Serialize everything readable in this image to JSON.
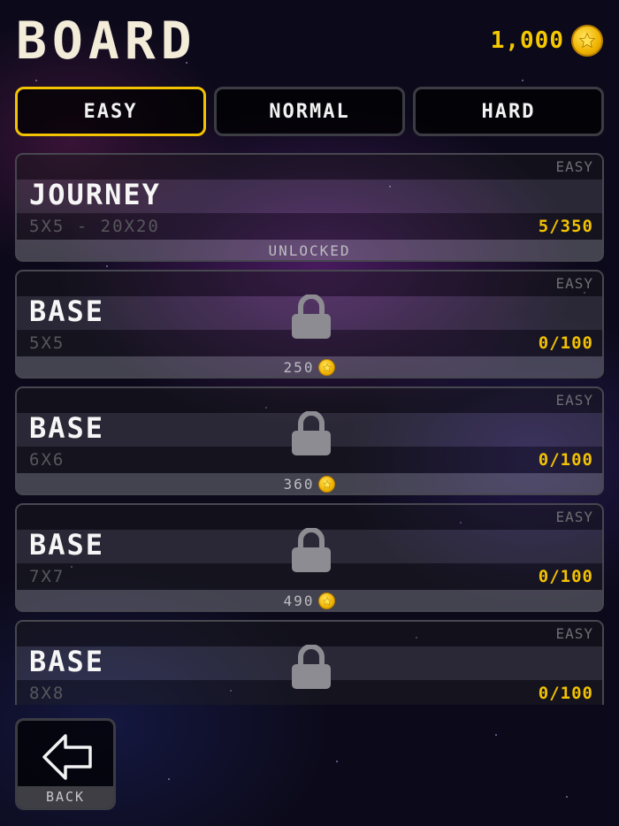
{
  "header": {
    "title": "BOARD",
    "coins": "1,000"
  },
  "tabs": [
    {
      "label": "EASY",
      "active": true
    },
    {
      "label": "NORMAL",
      "active": false
    },
    {
      "label": "HARD",
      "active": false
    }
  ],
  "boards": [
    {
      "difficulty": "EASY",
      "name": "JOURNEY",
      "size": "5X5 - 20X20",
      "progress": "5/350",
      "footer": "UNLOCKED",
      "locked": false
    },
    {
      "difficulty": "EASY",
      "name": "BASE",
      "size": "5X5",
      "progress": "0/100",
      "footer": "250",
      "locked": true
    },
    {
      "difficulty": "EASY",
      "name": "BASE",
      "size": "6X6",
      "progress": "0/100",
      "footer": "360",
      "locked": true
    },
    {
      "difficulty": "EASY",
      "name": "BASE",
      "size": "7X7",
      "progress": "0/100",
      "footer": "490",
      "locked": true
    },
    {
      "difficulty": "EASY",
      "name": "BASE",
      "size": "8X8",
      "progress": "0/100",
      "footer": "",
      "locked": true
    }
  ],
  "back": {
    "label": "BACK"
  },
  "colors": {
    "accent": "#f3c200",
    "title": "#f3ecd9",
    "coin": "#f5c800"
  },
  "icons": {
    "coin": "star-coin-icon",
    "lock": "lock-icon",
    "back": "back-arrow-icon"
  }
}
